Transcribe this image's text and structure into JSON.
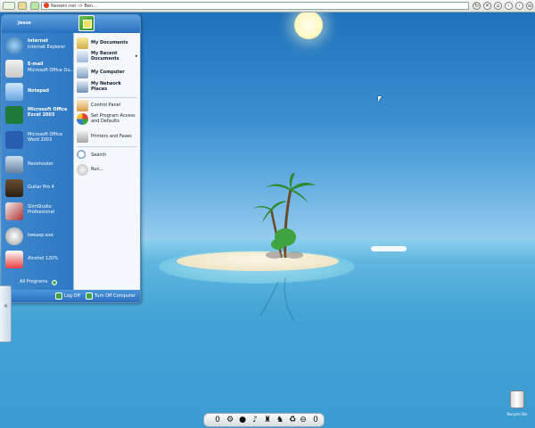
{
  "browser_bar": {
    "address_text": "Neowin.net -> Ben..."
  },
  "start_menu": {
    "user_name": "Jesus",
    "pinned": [
      {
        "title": "Internet",
        "subtitle": "Internet Explorer",
        "icon": "internet-explorer-icon"
      },
      {
        "title": "E-mail",
        "subtitle": "Microsoft Office Ou...",
        "icon": "email-icon"
      },
      {
        "title": "Notepad",
        "subtitle": "",
        "icon": "notepad-icon"
      },
      {
        "title": "Microsoft Office Excel 2003",
        "subtitle": "",
        "icon": "excel-icon"
      },
      {
        "title": "Microsoft Office Word 2003",
        "subtitle": "",
        "icon": "word-icon"
      },
      {
        "title": "Neoshooter",
        "subtitle": "",
        "icon": "neoshooter-icon"
      },
      {
        "title": "Guitar Pro 4",
        "subtitle": "",
        "icon": "guitar-pro-icon"
      },
      {
        "title": "SlimStudio Professional",
        "subtitle": "",
        "icon": "slimstudio-icon"
      },
      {
        "title": "tweaxp.exe",
        "subtitle": "",
        "icon": "tweaxp-icon"
      },
      {
        "title": "Alcohol 120%",
        "subtitle": "",
        "icon": "alcohol-icon"
      }
    ],
    "right_items": [
      {
        "label": "My Documents",
        "bold": true,
        "icon": "my-documents-icon"
      },
      {
        "label": "My Recent Documents",
        "bold": true,
        "icon": "recent-documents-icon"
      },
      {
        "label": "My Computer",
        "bold": true,
        "icon": "my-computer-icon"
      },
      {
        "label": "My Network Places",
        "bold": true,
        "icon": "network-places-icon"
      },
      {
        "label": "Control Panel",
        "bold": false,
        "icon": "control-panel-icon"
      },
      {
        "label": "Set Program Access and Defaults",
        "bold": false,
        "icon": "program-access-icon"
      },
      {
        "label": "Printers and Faxes",
        "bold": false,
        "icon": "printer-icon"
      },
      {
        "label": "Search",
        "bold": false,
        "icon": "search-icon"
      },
      {
        "label": "Run...",
        "bold": false,
        "icon": "run-icon"
      }
    ],
    "all_programs": "All Programs",
    "log_off": "Log Off",
    "turn_off": "Turn Off Computer"
  },
  "desktop": {
    "recycle_bin_label": "Recycle Bin"
  },
  "dock_icons": [
    "0",
    "⚙",
    "●",
    "♪",
    "♜",
    "♞",
    "♻",
    "⊖",
    "0"
  ]
}
